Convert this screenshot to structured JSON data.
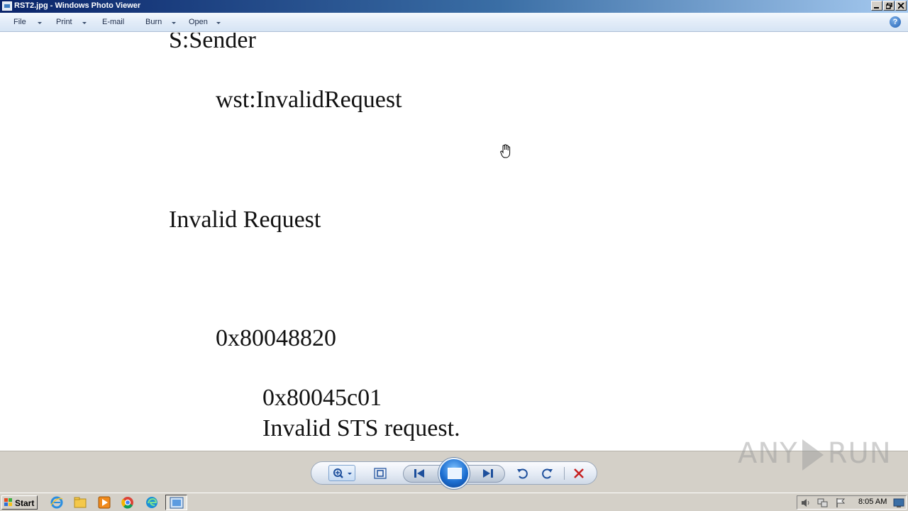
{
  "window": {
    "title": "RST2.jpg - Windows Photo Viewer"
  },
  "menu": {
    "items": [
      {
        "label": "File",
        "has_dropdown": true
      },
      {
        "label": "Print",
        "has_dropdown": true
      },
      {
        "label": "E-mail",
        "has_dropdown": false
      },
      {
        "label": "Burn",
        "has_dropdown": true
      },
      {
        "label": "Open",
        "has_dropdown": true
      }
    ],
    "help_label": "?"
  },
  "image_content": {
    "lines": [
      {
        "text": "S:Sender"
      },
      {
        "text": "wst:InvalidRequest"
      },
      {
        "text": "Invalid Request"
      },
      {
        "text": "0x80048820"
      },
      {
        "text": "0x80045c01"
      },
      {
        "text": "Invalid STS request."
      }
    ]
  },
  "controls": {
    "icons": [
      "zoom-icon",
      "actual-size-icon",
      "previous-icon",
      "slideshow-icon",
      "next-icon",
      "rotate-counterclockwise-icon",
      "rotate-clockwise-icon",
      "delete-icon"
    ]
  },
  "watermark": {
    "left": "ANY",
    "right": "RUN"
  },
  "taskbar": {
    "start_label": "Start",
    "pinned_icons": [
      "internet-explorer-icon",
      "file-explorer-icon",
      "media-player-icon",
      "chrome-icon",
      "edge-icon",
      "photo-viewer-icon"
    ],
    "clock": "8:05 AM"
  },
  "colors": {
    "titlebar_start": "#0a246a",
    "titlebar_end": "#a6caf0",
    "delete_red": "#c62020",
    "nav_blue": "#1d4f9c"
  }
}
